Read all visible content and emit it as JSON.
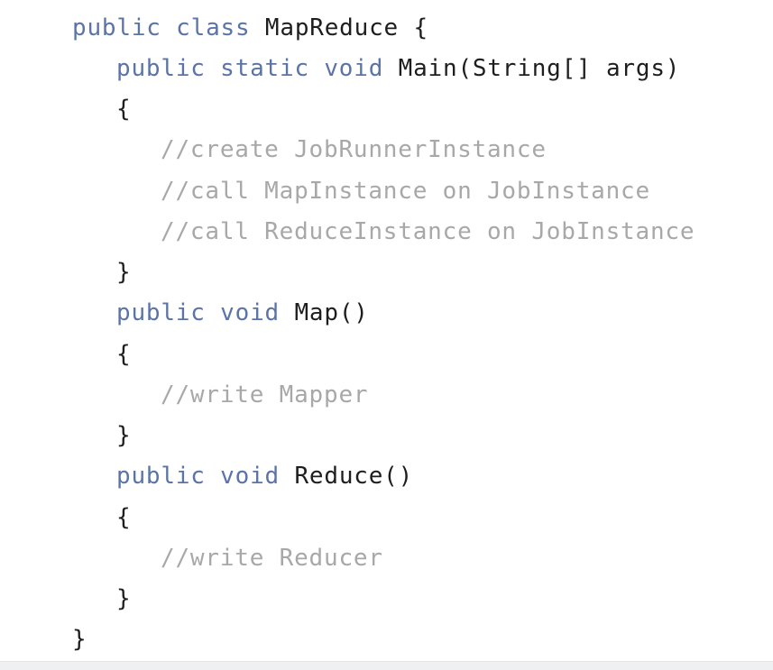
{
  "code": {
    "l1": {
      "kw": "public class ",
      "id": "MapReduce {"
    },
    "l2": {
      "kw": "public static void ",
      "id": "Main(String[] args)"
    },
    "l3": {
      "id": "{"
    },
    "l4": {
      "cm": "//create JobRunnerInstance"
    },
    "l5": {
      "cm": "//call MapInstance on JobInstance"
    },
    "l6": {
      "cm": "//call ReduceInstance on JobInstance"
    },
    "l7": {
      "id": "}"
    },
    "l8": {
      "kw": "public void ",
      "id": "Map()"
    },
    "l9": {
      "id": "{"
    },
    "l10": {
      "cm": "//write Mapper"
    },
    "l11": {
      "id": "}"
    },
    "l12": {
      "kw": "public void ",
      "id": "Reduce()"
    },
    "l13": {
      "id": "{"
    },
    "l14": {
      "cm": "//write Reducer"
    },
    "l15": {
      "id": "}"
    },
    "l16": {
      "id": "}"
    }
  },
  "colors": {
    "keyword": "#5b74a8",
    "identifier": "#1e1e1e",
    "comment": "#a8a8a8",
    "background": "#ffffff"
  }
}
